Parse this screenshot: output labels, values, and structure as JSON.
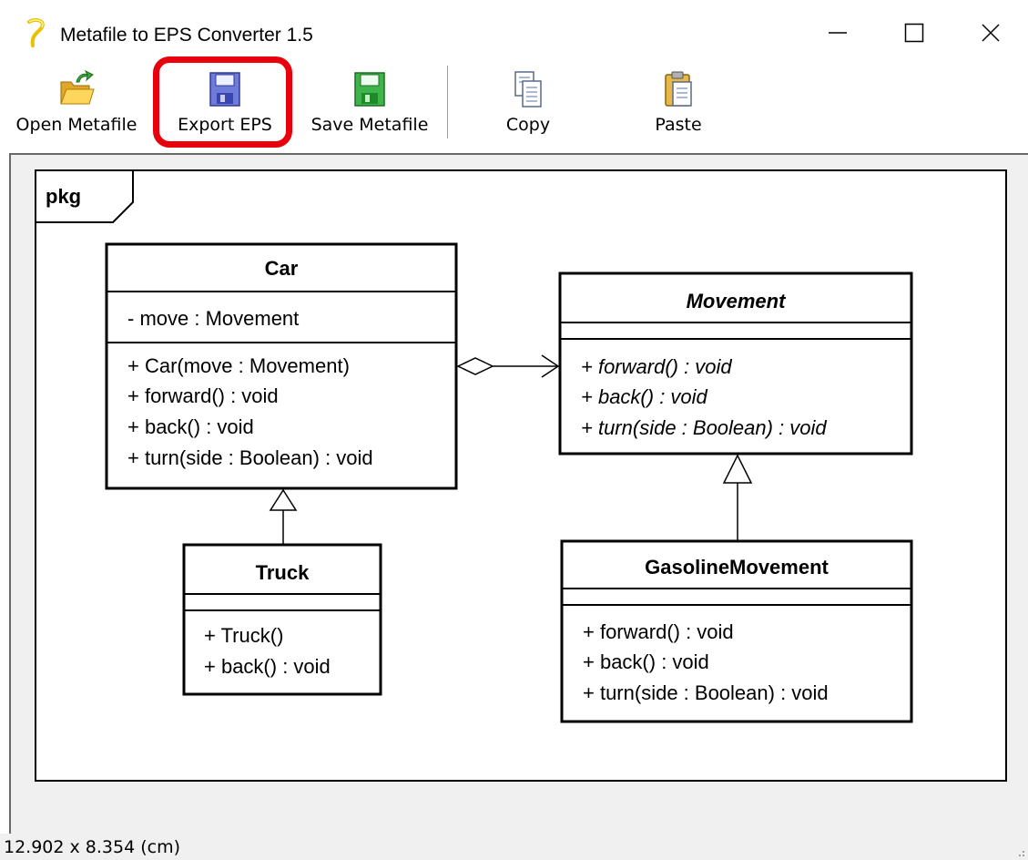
{
  "window": {
    "title": "Metafile to EPS Converter 1.5",
    "app_icon": "metafile-app-icon",
    "controls": [
      "minimize-icon",
      "maximize-icon",
      "close-icon"
    ]
  },
  "toolbar": {
    "buttons": [
      {
        "label": "Open Metafile",
        "icon": "open-folder-icon"
      },
      {
        "label": "Export EPS",
        "icon": "blue-floppy-disk-icon"
      },
      {
        "label": "Save Metafile",
        "icon": "green-floppy-disk-icon"
      },
      {
        "label": "Copy",
        "icon": "copy-icon"
      },
      {
        "label": "Paste",
        "icon": "paste-icon"
      }
    ],
    "highlight_color": "#e8000d"
  },
  "diagram": {
    "package_label": "pkg",
    "classes": {
      "car": {
        "name": "Car",
        "attributes": [
          "- move : Movement"
        ],
        "operations": [
          "+ Car(move : Movement)",
          "+ forward() : void",
          "+ back() : void",
          "+ turn(side : Boolean) : void"
        ]
      },
      "movement": {
        "name": "Movement",
        "abstract": true,
        "attributes": [],
        "operations": [
          "+ forward() : void",
          "+ back() : void",
          "+ turn(side : Boolean) : void"
        ]
      },
      "truck": {
        "name": "Truck",
        "attributes": [],
        "operations": [
          "+ Truck()",
          "+ back() : void"
        ]
      },
      "gasoline": {
        "name": "GasolineMovement",
        "attributes": [],
        "operations": [
          "+ forward() : void",
          "+ back() : void",
          "+ turn(side : Boolean) : void"
        ]
      }
    }
  },
  "status": {
    "size_text": "12.902 x 8.354 (cm)"
  }
}
